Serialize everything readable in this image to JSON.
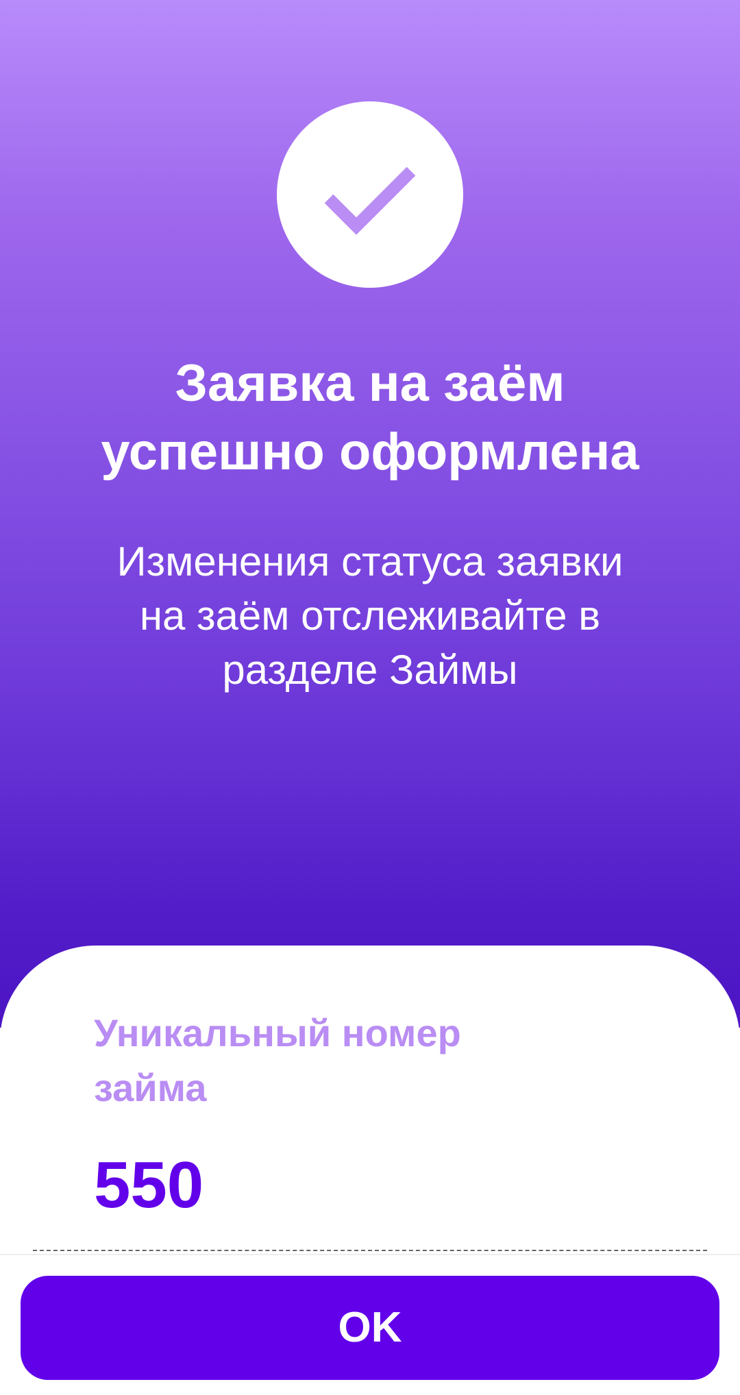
{
  "header": {
    "title_lines": [
      "Заявка на заём",
      "успешно оформлена"
    ],
    "subtitle_lines": [
      "Изменения статуса заявки",
      "на заём отслеживайте в",
      "разделе Займы"
    ],
    "icon": "checkmark-icon"
  },
  "card": {
    "label_lines": [
      "Уникальный номер",
      "займа"
    ],
    "value": "550"
  },
  "actions": {
    "ok_label": "OK"
  },
  "colors": {
    "accent": "#6200EA",
    "label": "#B98DF3",
    "gradient_top": "#B88BFB",
    "gradient_bottom": "#4C14C4",
    "check": "#B98DF3"
  }
}
